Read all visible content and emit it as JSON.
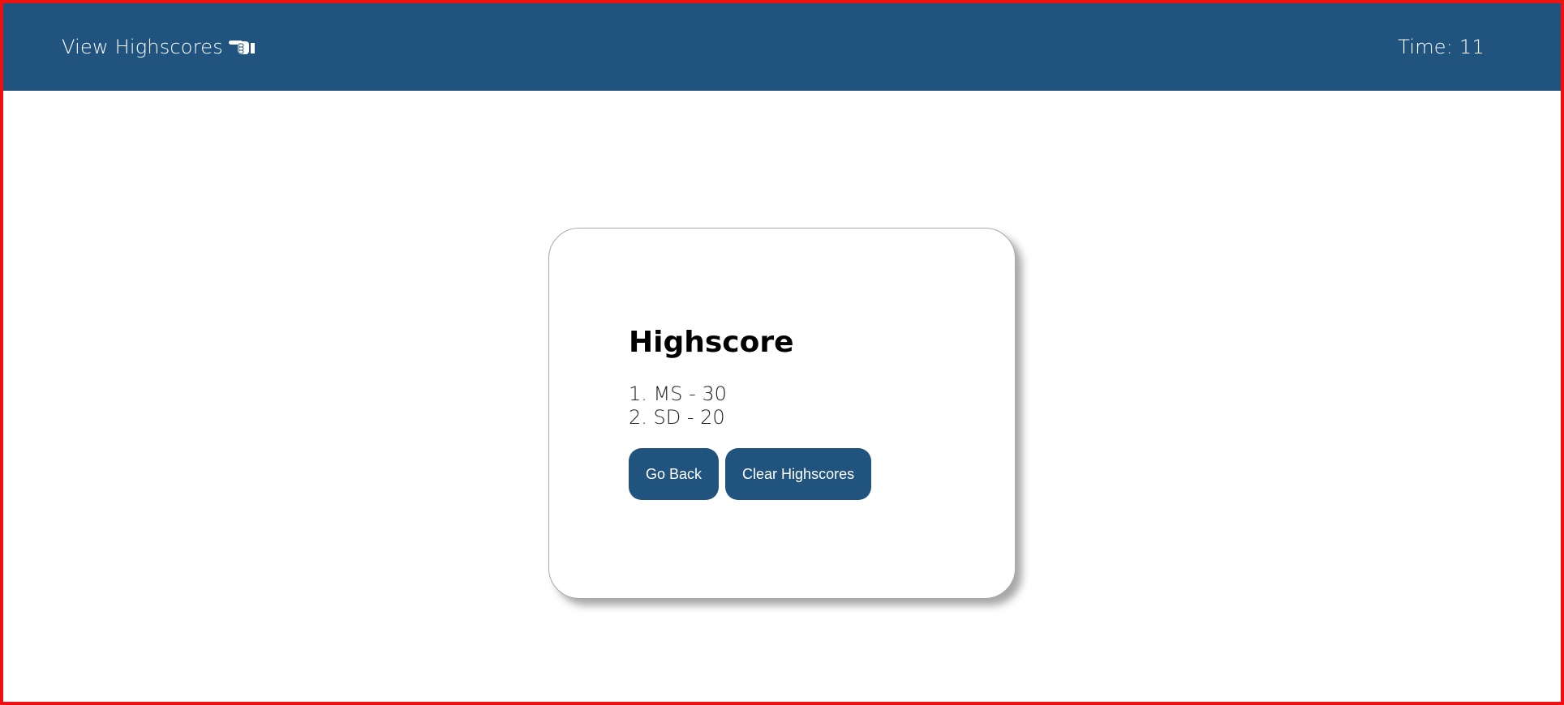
{
  "header": {
    "view_highscores_label": "View Highscores",
    "view_highscores_icon": "pointing-hand-icon",
    "timer_label": "Time:",
    "timer_value": "11"
  },
  "card": {
    "title": "Highscore",
    "scores": [
      "1. MS - 30",
      "2. SD - 20"
    ],
    "go_back_label": "Go Back",
    "clear_label": "Clear Highscores"
  },
  "colors": {
    "header_bg": "#20537d",
    "button_bg": "#20537d",
    "frame_border": "#ee1111"
  }
}
